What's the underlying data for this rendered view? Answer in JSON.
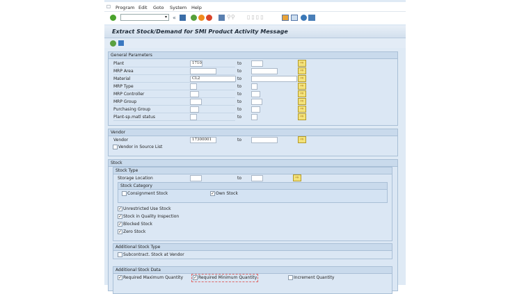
{
  "menu": [
    "Program",
    "Edit",
    "Goto",
    "System",
    "Help"
  ],
  "title": "Extract Stock/Demand for SMI Product Activity Message",
  "to_label": "to",
  "general": {
    "header": "General Parameters",
    "rows": [
      {
        "label": "Plant",
        "low": "1710",
        "high": ""
      },
      {
        "label": "MRP Area",
        "low": "",
        "high": ""
      },
      {
        "label": "Material",
        "low": "CL2",
        "high": ""
      },
      {
        "label": "MRP Type",
        "low": "",
        "high": ""
      },
      {
        "label": "MRP Controller",
        "low": "",
        "high": ""
      },
      {
        "label": "MRP Group",
        "low": "",
        "high": ""
      },
      {
        "label": "Purchasing Group",
        "low": "",
        "high": ""
      },
      {
        "label": "Plant-sp.matl status",
        "low": "",
        "high": ""
      }
    ]
  },
  "vendor": {
    "header": "Vendor",
    "label": "Vendor",
    "low": "17300001",
    "high": "",
    "source_list": "Vendor in Source List"
  },
  "stock": {
    "header": "Stock",
    "stock_type": "Stock Type",
    "storage_location": "Storage Location",
    "category": {
      "header": "Stock Category",
      "consignment": "Consignment Stock",
      "own": "Own Stock"
    },
    "checks": [
      "Unrestricted Use Stock",
      "Stock in Quality Inspection",
      "Blocked Stock",
      "Zero Stock"
    ],
    "additional_type": {
      "header": "Additional Stock Type",
      "subcontract": "Subcontract. Stock at Vendor"
    },
    "additional_data": {
      "header": "Additional Stock Data",
      "max": "Required Maximum Quantity",
      "min": "Required Minimum Quantity",
      "inc": "Increment Quantity"
    }
  },
  "check_mark": "✓",
  "multi_icon": "⇨"
}
